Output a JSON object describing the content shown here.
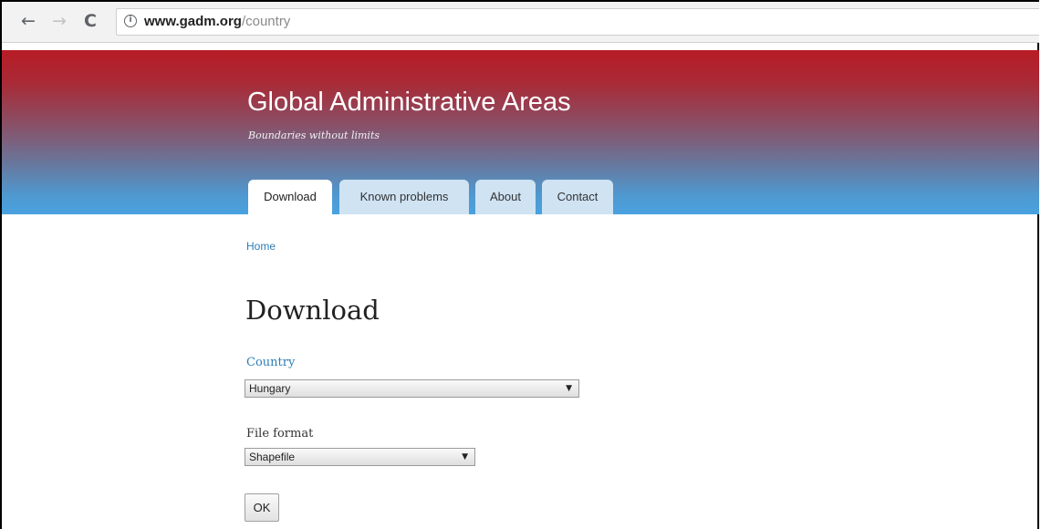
{
  "browser": {
    "url_host": "www.gadm.org",
    "url_path": "/country",
    "back_icon": "←",
    "forward_icon": "→",
    "reload_icon": "C",
    "info_icon": "i"
  },
  "site": {
    "title": "Global Administrative Areas",
    "slogan": "Boundaries without limits"
  },
  "tabs": [
    {
      "label": "Download",
      "active": true
    },
    {
      "label": "Known problems",
      "active": false
    },
    {
      "label": "About",
      "active": false
    },
    {
      "label": "Contact",
      "active": false
    }
  ],
  "breadcrumb": {
    "home": "Home"
  },
  "page": {
    "title": "Download"
  },
  "form": {
    "country_label": "Country",
    "country_value": "Hungary",
    "file_format_label": "File format",
    "file_format_value": "Shapefile",
    "select_arrow": "▼",
    "ok_label": "OK"
  },
  "colors": {
    "header_top": "#b71c25",
    "header_bottom": "#49a2df",
    "link": "#2d7fb8",
    "tab_inactive": "#cfe3f3"
  }
}
